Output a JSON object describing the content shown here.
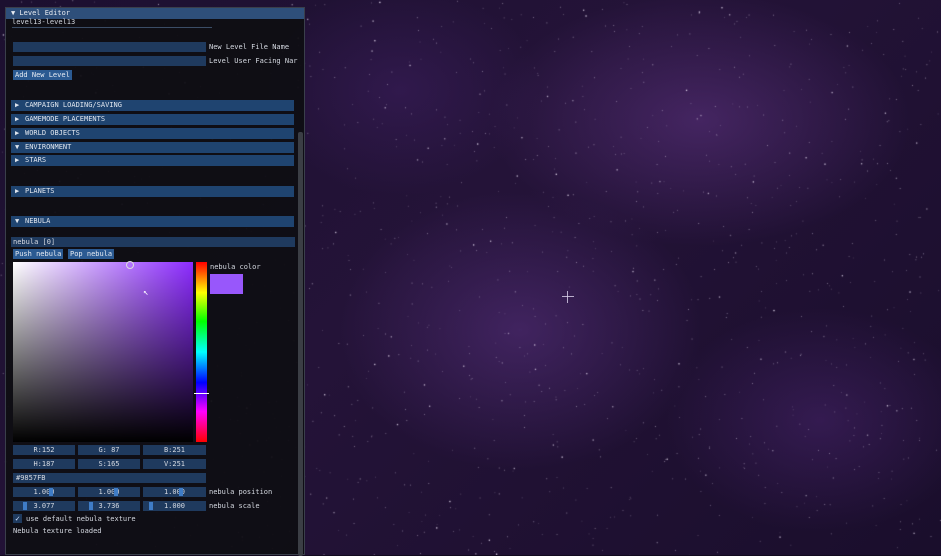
{
  "panel": {
    "title": "▼ Level Editor",
    "level_name": "level13-level13",
    "new_file_label": "New Level File Name",
    "new_user_label": "Level User Facing Nar",
    "add_button": "Add New Level",
    "sections": [
      {
        "arrow": "▶",
        "label": "CAMPAIGN LOADING/SAVING"
      },
      {
        "arrow": "▶",
        "label": "GAMEMODE PLACEMENTS"
      },
      {
        "arrow": "▶",
        "label": "WORLD OBJECTS"
      },
      {
        "arrow": "▼",
        "label": "ENVIRONMENT"
      },
      {
        "arrow": "▶",
        "label": "STARS"
      }
    ],
    "planets": {
      "arrow": "▶",
      "label": "PLANETS"
    },
    "nebula": {
      "arrow": "▼",
      "label": "NEBULA"
    },
    "nebula_item": "nebula [0]",
    "push_button": "Push nebula",
    "pop_button": "Pop nebula",
    "color_label": "nebula color",
    "rgb": [
      "R:152",
      "G: 87",
      "B:251"
    ],
    "hsv": [
      "H:187",
      "S:165",
      "V:251"
    ],
    "hex": "#9857FB",
    "position_values": [
      "1.000",
      "1.000",
      "1.000"
    ],
    "position_label": "nebula position",
    "scale_values": [
      "3.077",
      "3.736",
      "1.000"
    ],
    "scale_label": "nebula scale",
    "texture_check_label": "use default nebula texture",
    "texture_status": "Nebula texture loaded"
  },
  "colors": {
    "swatch": "#9857fb",
    "accent": "#2b5a92",
    "header": "#1f4470"
  }
}
